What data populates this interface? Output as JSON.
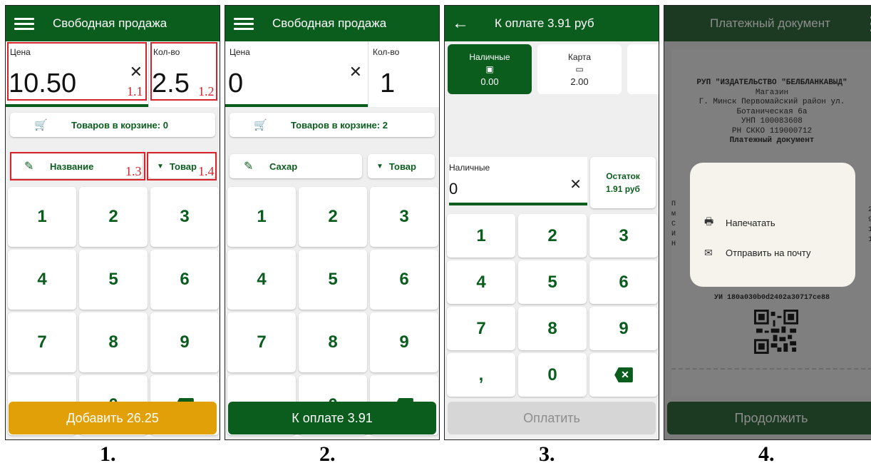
{
  "colors": {
    "brand_green": "#0b5d1e",
    "accent_orange": "#e2a008",
    "highlight_red": "#d9222a"
  },
  "screens": [
    {
      "title": "Свободная продажа",
      "price_label": "Цена",
      "price_value": "10.50",
      "qty_label": "Кол-во",
      "qty_value": "2.5",
      "cart_label": "Товаров в корзине: 0",
      "name_label": "Название",
      "type_label": "Товар",
      "action_label": "Добавить 26.25",
      "callouts": [
        "1.1",
        "1.2",
        "1.3",
        "1.4"
      ],
      "caption": "1."
    },
    {
      "title": "Свободная продажа",
      "price_label": "Цена",
      "price_value": "0",
      "qty_label": "Кол-во",
      "qty_value": "1",
      "cart_label": "Товаров в корзине: 2",
      "name_label": "Сахар",
      "type_label": "Товар",
      "action_label": "К оплате 3.91",
      "caption": "2."
    },
    {
      "title": "К оплате 3.91 руб",
      "tabs": [
        {
          "label": "Наличные",
          "amount": "0.00",
          "icon": "cash-icon"
        },
        {
          "label": "Карта",
          "amount": "2.00",
          "icon": "card-icon"
        }
      ],
      "cash_label": "Наличные",
      "cash_value": "0",
      "rest_label": "Остаток",
      "rest_value": "1.91 руб",
      "action_label": "Оплатить",
      "caption": "3."
    },
    {
      "title": "Платежный документ",
      "receipt": {
        "org": "РУП \"ИЗДАТЕЛЬСТВО \"БЕЛБЛАНКАВЫД\"",
        "shop": "Магазин",
        "address_1": "Г. Минск Первомайский район ул.",
        "address_2": "Ботаническая 6а",
        "unp": "УНП 100083608",
        "rn": "РН СККО 119000712",
        "doc": "Платежный документ",
        "ui": "УИ 180a030b0d2402a30717ce88",
        "left_chars": "П\nм\nС\nИ\nН",
        "right_chars": "2\n9\n1\n1"
      },
      "dialog": {
        "print_label": "Напечатать",
        "email_label": "Отправить на почту"
      },
      "action_label": "Продолжить",
      "caption": "4."
    }
  ],
  "keypad": [
    "1",
    "2",
    "3",
    "4",
    "5",
    "6",
    "7",
    "8",
    "9",
    ",",
    "0",
    "⌫"
  ]
}
